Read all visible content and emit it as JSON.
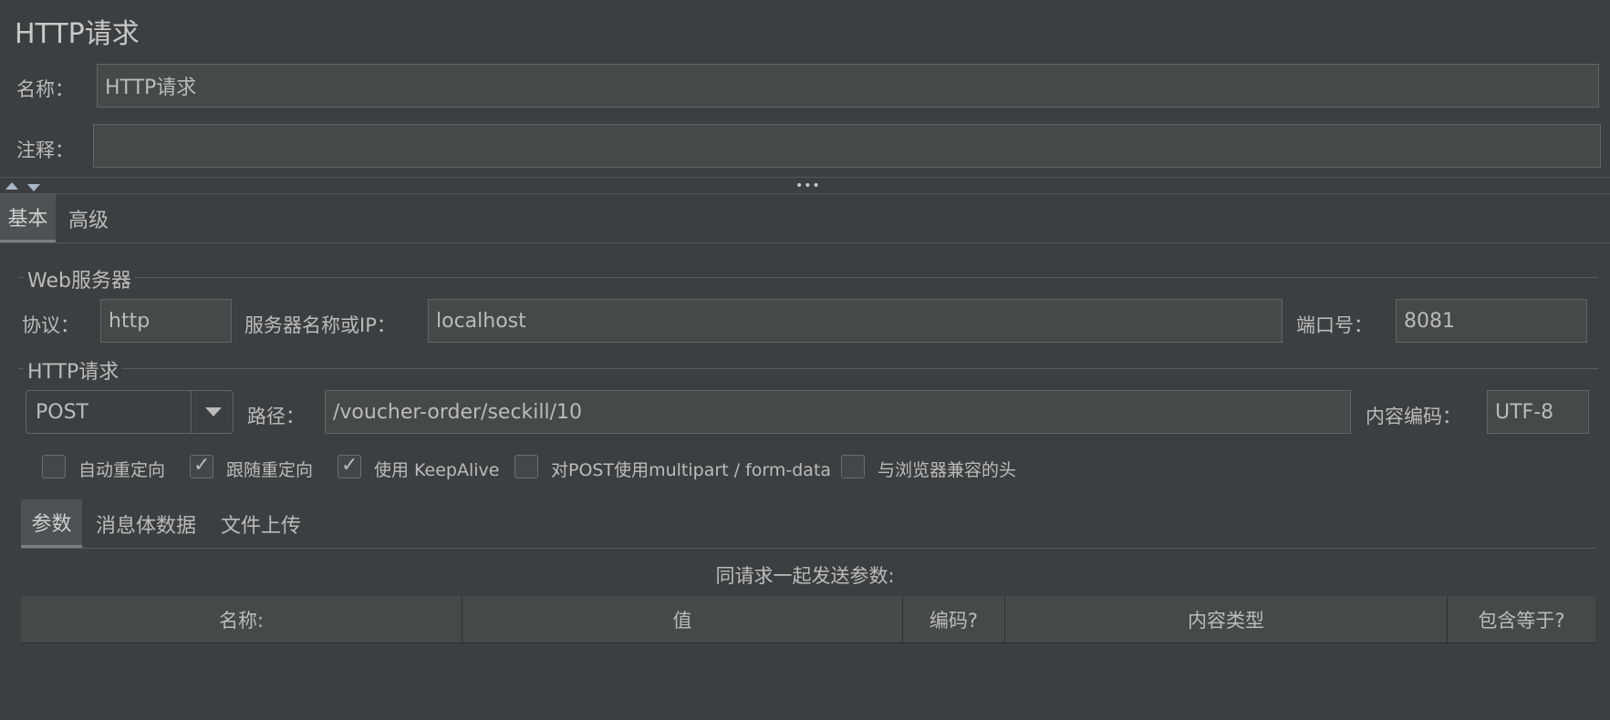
{
  "header": {
    "title": "HTTP请求"
  },
  "name_row": {
    "label": "名称：",
    "value": "HTTP请求"
  },
  "comment_row": {
    "label": "注释：",
    "value": ""
  },
  "splitter": {
    "dots": "•••"
  },
  "main_tabs": [
    {
      "label": "基本",
      "selected": true
    },
    {
      "label": "高级",
      "selected": false
    }
  ],
  "web_server": {
    "group_title": "Web服务器",
    "protocol_label": "协议：",
    "protocol_value": "http",
    "server_label": "服务器名称或IP：",
    "server_value": "localhost",
    "port_label": "端口号：",
    "port_value": "8081"
  },
  "http_request": {
    "group_title": "HTTP请求",
    "method_value": "POST",
    "path_label": "路径：",
    "path_value": "/voucher-order/seckill/10",
    "encoding_label": "内容编码：",
    "encoding_value": "UTF-8"
  },
  "options": [
    {
      "label": "自动重定向",
      "checked": false
    },
    {
      "label": "跟随重定向",
      "checked": true
    },
    {
      "label": "使用 KeepAlive",
      "checked": true
    },
    {
      "label": "对POST使用multipart / form-data",
      "checked": false
    },
    {
      "label": "与浏览器兼容的头",
      "checked": false
    }
  ],
  "sub_tabs": [
    {
      "label": "参数",
      "selected": true
    },
    {
      "label": "消息体数据",
      "selected": false
    },
    {
      "label": "文件上传",
      "selected": false
    }
  ],
  "params": {
    "caption": "同请求一起发送参数:",
    "columns": [
      "名称:",
      "值",
      "编码?",
      "内容类型",
      "包含等于?"
    ]
  },
  "colors": {
    "background": "#3c3f41",
    "field": "#45494a",
    "text": "#bbbbbb"
  }
}
